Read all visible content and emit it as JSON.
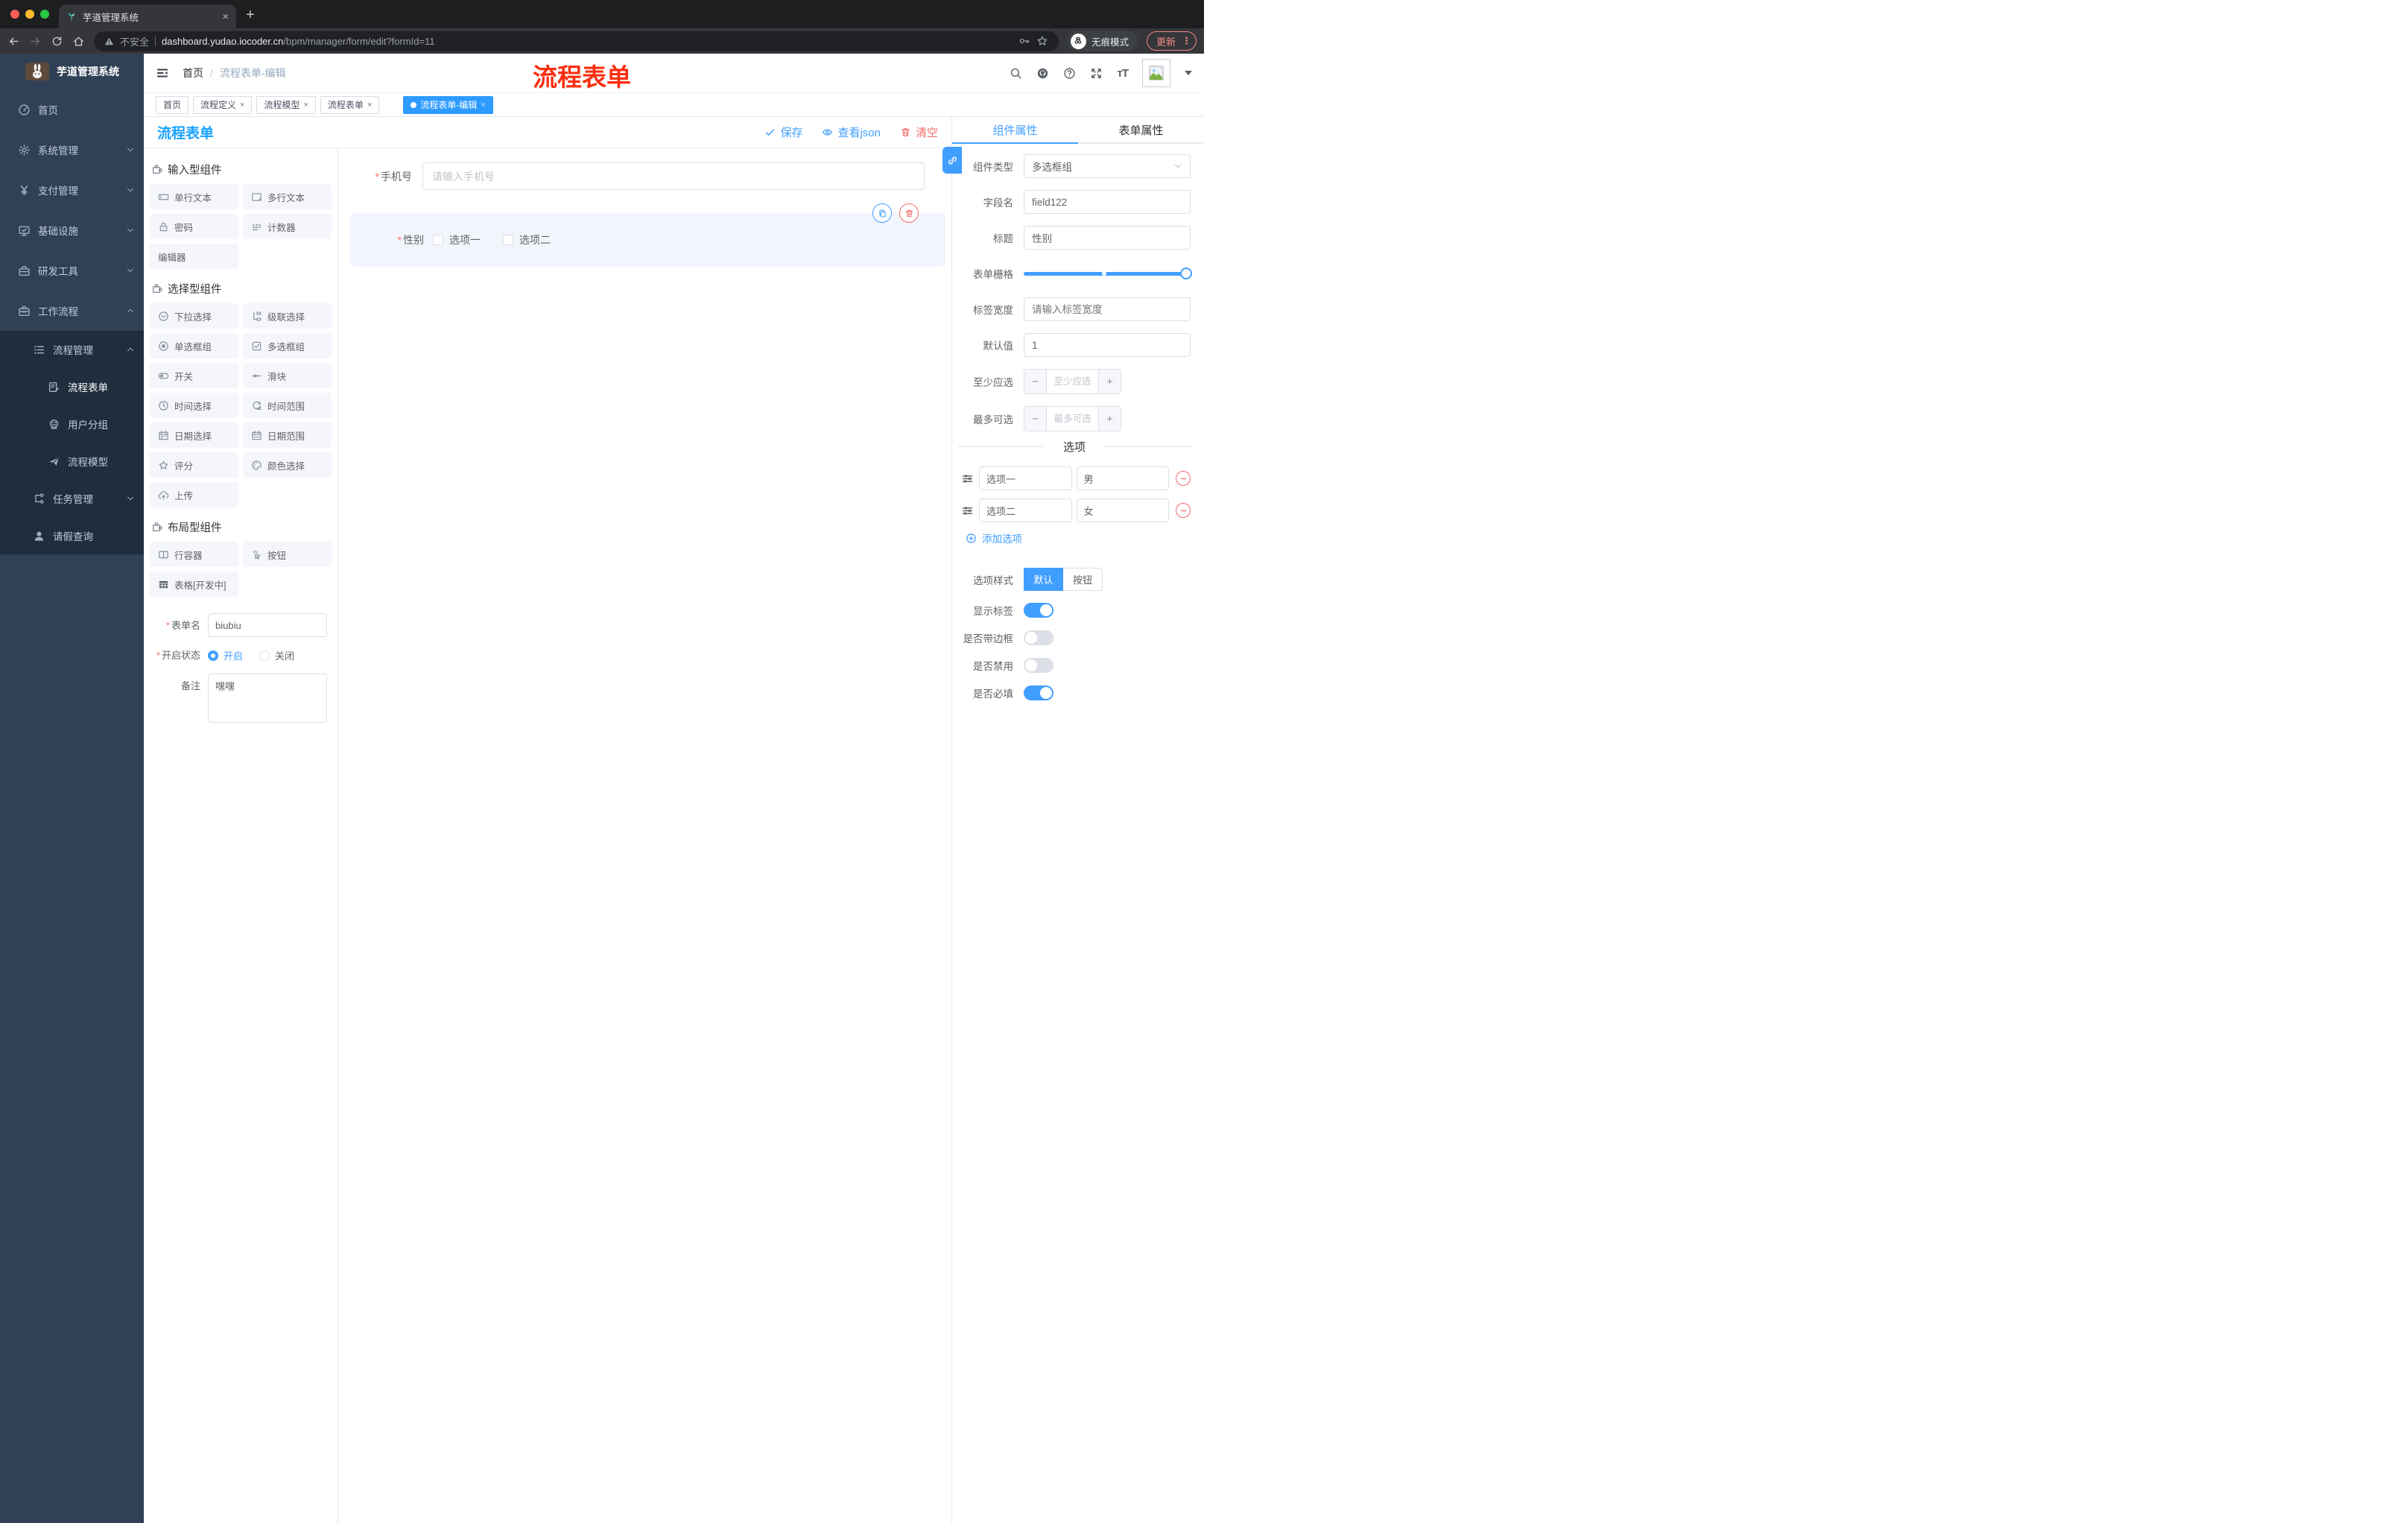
{
  "browser": {
    "tab_title": "芋道管理系统",
    "security_label": "不安全",
    "url_host": "dashboard.yudao.iocoder.cn",
    "url_path": "/bpm/manager/form/edit?formId=11",
    "incognito_label": "无痕模式",
    "update_label": "更新"
  },
  "annotation": {
    "text": "流程表单",
    "color": "#fa2f10"
  },
  "sidebar": {
    "app_title": "芋道管理系统",
    "items": [
      {
        "label": "首页",
        "icon": "dashboard-icon",
        "cls": "l0"
      },
      {
        "label": "系统管理",
        "icon": "gear-icon",
        "cls": "l0",
        "expandable": true
      },
      {
        "label": "支付管理",
        "icon": "yen-icon",
        "cls": "l0",
        "expandable": true
      },
      {
        "label": "基础设施",
        "icon": "monitor-icon",
        "cls": "l0",
        "expandable": true
      },
      {
        "label": "研发工具",
        "icon": "toolbox-icon",
        "cls": "l0",
        "expandable": true
      },
      {
        "label": "工作流程",
        "icon": "briefcase-icon",
        "cls": "l0",
        "expandable": true,
        "expanded": true
      },
      {
        "label": "流程管理",
        "icon": "list-tree-icon",
        "cls": "l1 sub",
        "expandable": true,
        "expanded": true
      },
      {
        "label": "流程表单",
        "icon": "doc-edit-icon",
        "cls": "l2 sub",
        "active": true
      },
      {
        "label": "用户分组",
        "icon": "user-group-icon",
        "cls": "l2 sub"
      },
      {
        "label": "流程模型",
        "icon": "paper-plane-icon",
        "cls": "l2 sub"
      },
      {
        "label": "任务管理",
        "icon": "tree-icon",
        "cls": "l1 sub",
        "expandable": true
      },
      {
        "label": "请假查询",
        "icon": "person-icon",
        "cls": "l1 sub"
      }
    ]
  },
  "header": {
    "breadcrumb": [
      "首页",
      "流程表单-编辑"
    ]
  },
  "tags": {
    "tabs": [
      {
        "label": "首页"
      },
      {
        "label": "流程定义",
        "closable": true
      },
      {
        "label": "流程模型",
        "closable": true
      },
      {
        "label": "流程表单",
        "closable": true
      },
      {
        "label": "流程表单-编辑",
        "closable": true,
        "active": true
      }
    ]
  },
  "toolbar": {
    "title": "流程表单",
    "save_label": "保存",
    "view_json_label": "查看json",
    "clear_label": "清空"
  },
  "components_panel": {
    "sections": [
      {
        "title": "输入型组件",
        "icon": "puzzle-icon",
        "items": [
          {
            "label": "单行文本",
            "icon": "input-icon"
          },
          {
            "label": "多行文本",
            "icon": "textarea-icon"
          },
          {
            "label": "密码",
            "icon": "lock-icon"
          },
          {
            "label": "计数器",
            "icon": "counter-icon"
          },
          {
            "label": "编辑器"
          }
        ]
      },
      {
        "title": "选择型组件",
        "icon": "puzzle-icon",
        "items": [
          {
            "label": "下拉选择",
            "icon": "select-icon"
          },
          {
            "label": "级联选择",
            "icon": "cascade-icon"
          },
          {
            "label": "单选框组",
            "icon": "radio-icon"
          },
          {
            "label": "多选框组",
            "icon": "checkbox-icon"
          },
          {
            "label": "开关",
            "icon": "switch-icon"
          },
          {
            "label": "滑块",
            "icon": "slider-icon"
          },
          {
            "label": "时间选择",
            "icon": "clock-icon"
          },
          {
            "label": "时间范围",
            "icon": "time-range-icon"
          },
          {
            "label": "日期选择",
            "icon": "calendar-icon"
          },
          {
            "label": "日期范围",
            "icon": "date-range-icon"
          },
          {
            "label": "评分",
            "icon": "star-icon"
          },
          {
            "label": "颜色选择",
            "icon": "palette-icon"
          },
          {
            "label": "上传",
            "icon": "upload-icon"
          }
        ]
      },
      {
        "title": "布局型组件",
        "icon": "puzzle-icon",
        "items": [
          {
            "label": "行容器",
            "icon": "columns-icon"
          },
          {
            "label": "按钮",
            "icon": "click-icon"
          },
          {
            "label": "表格[开发中]",
            "icon": "table-icon",
            "dark": true
          }
        ]
      }
    ],
    "meta": {
      "form_name_label": "表单名",
      "form_name_value": "biubiu",
      "status_label": "开启状态",
      "status_on": "开启",
      "status_off": "关闭",
      "remark_label": "备注",
      "remark_value": "嘿嘿"
    }
  },
  "canvas": {
    "fields": [
      {
        "label": "手机号",
        "placeholder": "请输入手机号"
      },
      {
        "label": "性别",
        "options": [
          {
            "label": "选项一"
          },
          {
            "label": "选项二"
          }
        ]
      }
    ]
  },
  "inspector": {
    "tabs": [
      {
        "label": "组件属性",
        "active": true
      },
      {
        "label": "表单属性"
      }
    ],
    "component_type_label": "组件类型",
    "component_type_value": "多选框组",
    "field_name_label": "字段名",
    "field_name_value": "field122",
    "title_label": "标题",
    "title_value": "性别",
    "grid_label": "表单栅格",
    "label_width_label": "标签宽度",
    "label_width_placeholder": "请输入标签宽度",
    "default_label": "默认值",
    "default_value": "1",
    "min_label": "至少应选",
    "min_placeholder": "至少应选",
    "max_label": "最多可选",
    "max_placeholder": "最多可选",
    "options_divider": "选项",
    "options": [
      {
        "label": "选项一",
        "value": "男"
      },
      {
        "label": "选项二",
        "value": "女"
      }
    ],
    "add_option_label": "添加选项",
    "style_label": "选项样式",
    "style_options": [
      {
        "label": "默认",
        "on": true
      },
      {
        "label": "按钮"
      }
    ],
    "toggles": [
      {
        "label": "显示标签",
        "on": true
      },
      {
        "label": "是否带边框"
      },
      {
        "label": "是否禁用"
      },
      {
        "label": "是否必填",
        "on": true
      }
    ]
  },
  "colors": {
    "primary": "#409eff",
    "danger": "#f56c6c",
    "sidebar_bg": "#304156",
    "submenu_bg": "#1f2d3d",
    "selected_block_bg": "#f2f6fc",
    "annotation_red": "#fa2f10",
    "chrome_bg": "#35363a"
  }
}
